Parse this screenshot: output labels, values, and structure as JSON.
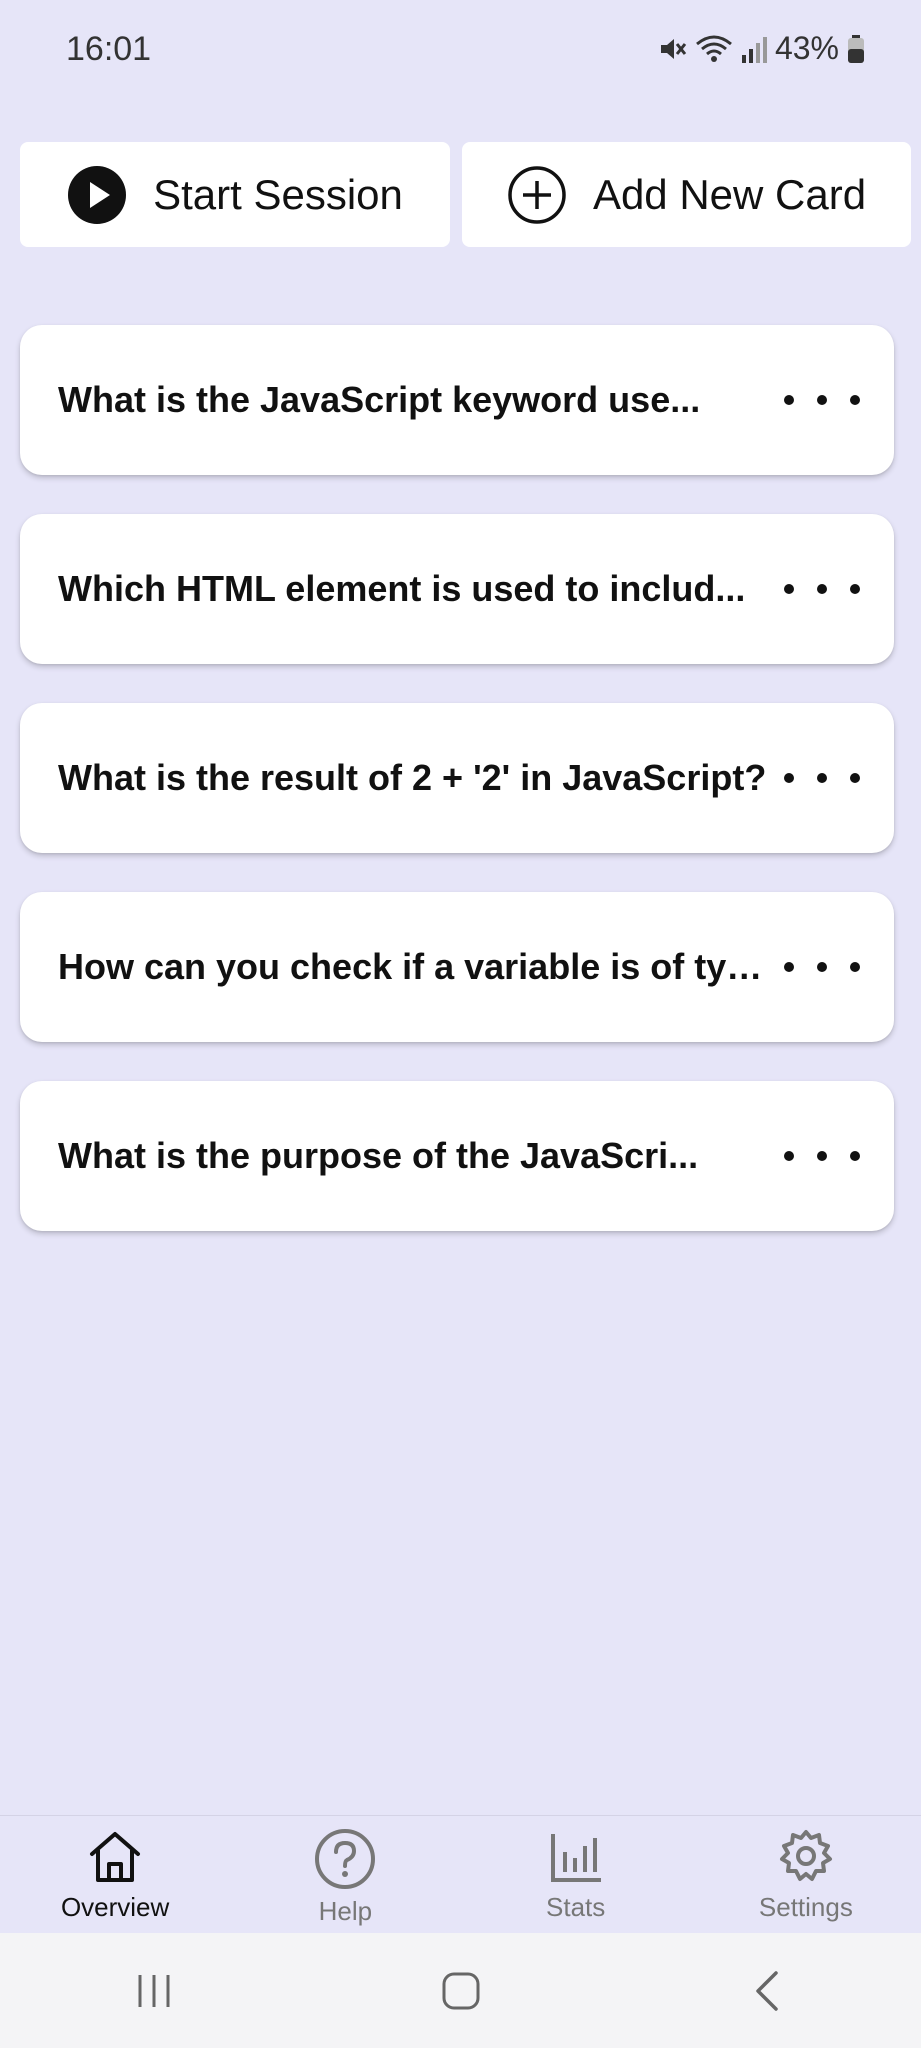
{
  "status_bar": {
    "time": "16:01",
    "battery": "43%"
  },
  "actions": {
    "start_session_label": "Start Session",
    "add_card_label": "Add New Card"
  },
  "cards": [
    {
      "text": "What is the JavaScript keyword use..."
    },
    {
      "text": "Which HTML element is used to includ..."
    },
    {
      "text": "What is the result of 2 + '2' in JavaScript?"
    },
    {
      "text": "How can you check if a variable is of typ..."
    },
    {
      "text": "What is the purpose of the JavaScri..."
    }
  ],
  "bottom_nav": {
    "items": [
      {
        "label": "Overview",
        "icon": "home-icon",
        "active": true
      },
      {
        "label": "Help",
        "icon": "help-icon",
        "active": false
      },
      {
        "label": "Stats",
        "icon": "stats-icon",
        "active": false
      },
      {
        "label": "Settings",
        "icon": "settings-icon",
        "active": false
      }
    ]
  },
  "colors": {
    "background": "#e6e5f8",
    "card": "#ffffff",
    "active_nav": "#111111",
    "inactive_nav": "#777777"
  }
}
